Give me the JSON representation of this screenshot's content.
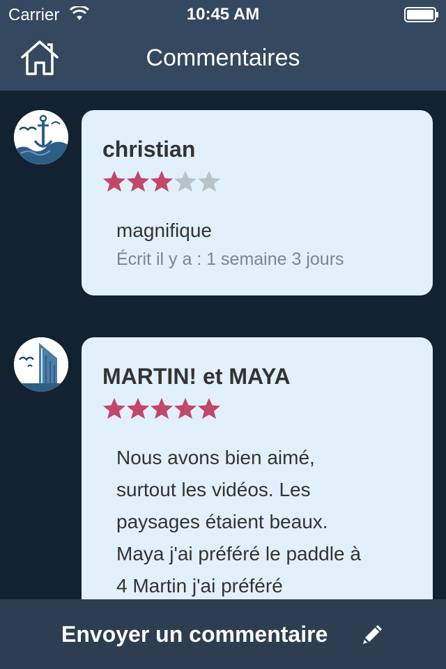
{
  "status_bar": {
    "carrier": "Carrier",
    "time": "10:45 AM",
    "icons": [
      "wifi-icon",
      "battery-icon"
    ]
  },
  "nav": {
    "title": "Commentaires",
    "home_icon": "home-icon"
  },
  "comments": [
    {
      "author": "christian",
      "rating": 3,
      "max_rating": 5,
      "text": "magnifique",
      "meta": "Écrit il y a : 1 semaine 3 jours",
      "avatar_icon": "anchor-seagull-avatar-icon"
    },
    {
      "author": "MARTIN! et MAYA",
      "rating": 5,
      "max_rating": 5,
      "text_lines": [
        "Nous avons bien aimé,",
        "surtout les vidéos. Les",
        "paysages étaient beaux.",
        "Maya j'ai préféré le paddle à",
        "4 Martin j'ai préféré"
      ],
      "avatar_icon": "ship-seagull-avatar-icon"
    }
  ],
  "footer": {
    "label": "Envoyer un commentaire",
    "icon": "pencil-icon"
  },
  "colors": {
    "header_bg": "#34485f",
    "content_bg": "#132230",
    "card_bg": "#e1f0fa",
    "star_filled": "#c2476a",
    "star_empty": "#b9c2c8",
    "footer_bg": "#2d3e50"
  }
}
